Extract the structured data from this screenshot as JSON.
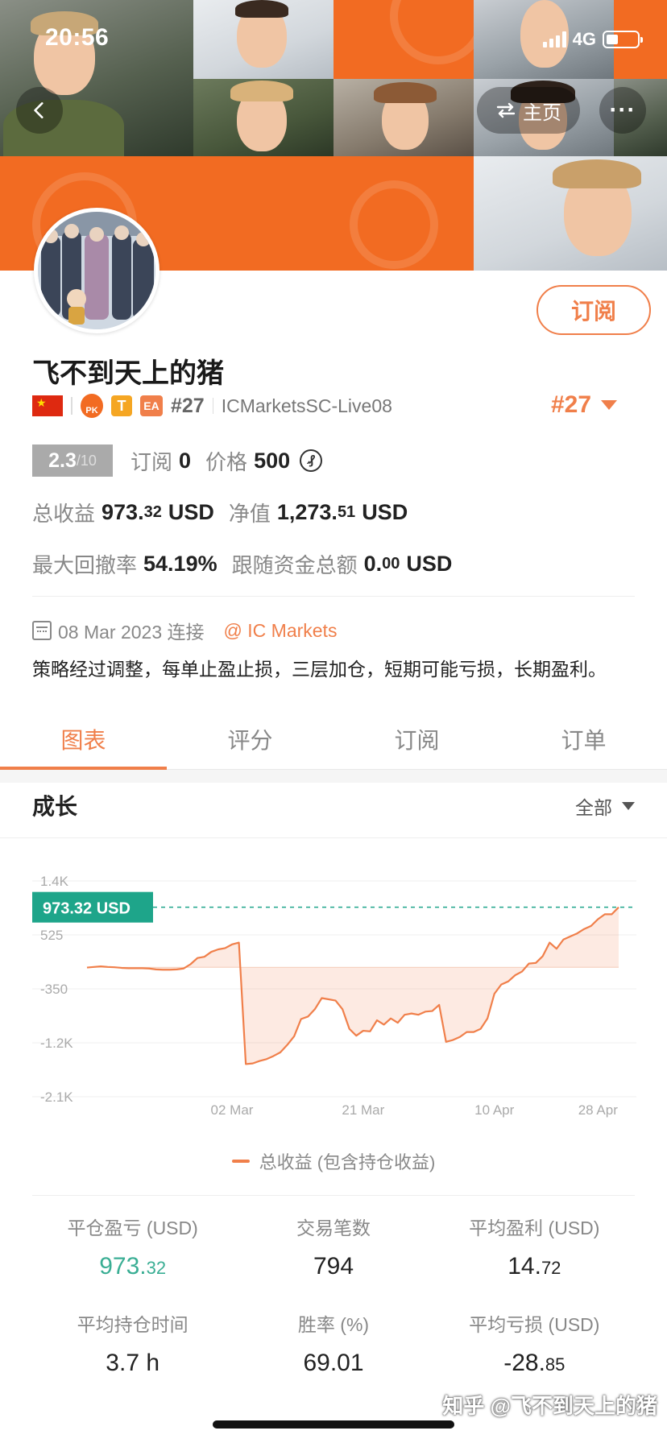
{
  "status_bar": {
    "time": "20:56",
    "network": "4G"
  },
  "nav": {
    "home_label": "主页",
    "more_label": "···"
  },
  "profile": {
    "username": "飞不到天上的猪",
    "subscribe_label": "订阅",
    "rank_small": "#27",
    "rank_big": "#27",
    "server": "ICMarketsSC-Live08",
    "badges": {
      "pk": "PK",
      "t": "T",
      "ea": "EA"
    }
  },
  "stats": {
    "score": "2.3",
    "score_max": "/10",
    "subscriptions_label": "订阅",
    "subscriptions_value": "0",
    "price_label": "价格",
    "price_value": "500",
    "price_currency_symbol": "₰",
    "total_profit_label": "总收益",
    "total_profit_int": "973.",
    "total_profit_dec": "32",
    "total_profit_unit": "USD",
    "equity_label": "净值",
    "equity_int": "1,273.",
    "equity_dec": "51",
    "equity_unit": "USD",
    "max_drawdown_label": "最大回撤率",
    "max_drawdown_value": "54.19%",
    "follow_funds_label": "跟随资金总额",
    "follow_funds_int": "0.",
    "follow_funds_dec": "00",
    "follow_funds_unit": "USD"
  },
  "connection": {
    "date": "08 Mar 2023 连接",
    "broker": "@ IC Markets"
  },
  "description": "策略经过调整，每单止盈止损，三层加仓，短期可能亏损，长期盈利。",
  "tabs": [
    {
      "label": "图表",
      "active": true
    },
    {
      "label": "评分",
      "active": false
    },
    {
      "label": "订阅",
      "active": false
    },
    {
      "label": "订单",
      "active": false
    }
  ],
  "chart_section": {
    "title": "成长",
    "filter_label": "全部"
  },
  "chart_data": {
    "type": "area",
    "current_value_label": "973.32 USD",
    "current_value": 973.32,
    "y_ticks": [
      "1.4K",
      "525",
      "-350",
      "-1.2K",
      "-2.1K"
    ],
    "y_tick_values": [
      1400,
      525,
      -350,
      -1225,
      -2100
    ],
    "ylim": [
      -2100,
      1400
    ],
    "x_ticks": [
      "02 Mar",
      "21 Mar",
      "10 Apr",
      "28 Apr"
    ],
    "x_tick_index": [
      21,
      40,
      59,
      74
    ],
    "x": [
      0,
      1,
      2,
      3,
      4,
      5,
      6,
      7,
      8,
      9,
      10,
      11,
      12,
      13,
      14,
      15,
      16,
      17,
      18,
      19,
      20,
      21,
      22,
      23,
      24,
      25,
      26,
      27,
      28,
      29,
      30,
      31,
      32,
      33,
      34,
      35,
      36,
      37,
      38,
      39,
      40,
      41,
      42,
      43,
      44,
      45,
      46,
      47,
      48,
      49,
      50,
      51,
      52,
      53,
      54,
      55,
      56,
      57,
      58,
      59,
      60,
      61,
      62,
      63,
      64,
      65,
      66,
      67,
      68,
      69,
      70,
      71,
      72,
      73,
      74,
      75,
      76,
      77
    ],
    "series": [
      {
        "name": "总收益 (包含持仓收益)",
        "color": "#f07f4a",
        "values": [
          -5,
          5,
          15,
          5,
          0,
          -10,
          -15,
          -15,
          -15,
          -20,
          -35,
          -40,
          -40,
          -35,
          -20,
          50,
          150,
          170,
          250,
          290,
          310,
          370,
          400,
          -1570,
          -1560,
          -1520,
          -1490,
          -1440,
          -1380,
          -1260,
          -1120,
          -840,
          -800,
          -680,
          -500,
          -520,
          -540,
          -680,
          -1000,
          -1110,
          -1030,
          -1040,
          -860,
          -930,
          -830,
          -900,
          -770,
          -750,
          -770,
          -720,
          -710,
          -610,
          -1210,
          -1180,
          -1130,
          -1050,
          -1050,
          -1000,
          -830,
          -430,
          -280,
          -230,
          -130,
          -70,
          60,
          70,
          180,
          400,
          300,
          450,
          500,
          550,
          620,
          670,
          780,
          860,
          860,
          973.32
        ]
      }
    ],
    "legend": [
      "总收益 (包含持仓收益)"
    ],
    "grid": true
  },
  "summary": [
    {
      "label": "平仓盈亏 (USD)",
      "int": "973.",
      "dec": "32",
      "green": true
    },
    {
      "label": "交易笔数",
      "int": "794",
      "dec": "",
      "green": false
    },
    {
      "label": "平均盈利 (USD)",
      "int": "14.",
      "dec": "72",
      "green": false
    },
    {
      "label": "平均持仓时间",
      "int": "3.7 h",
      "dec": "",
      "green": false
    },
    {
      "label": "胜率 (%)",
      "int": "69.01",
      "dec": "",
      "green": false
    },
    {
      "label": "平均亏损 (USD)",
      "int": "-28.",
      "dec": "85",
      "green": false
    }
  ],
  "watermark": "知乎 @飞不到天上的猪",
  "colors": {
    "accent": "#f07f4a",
    "banner_orange": "#f26b22",
    "profit_green": "#3aae94",
    "label_bg": "#1ea58a"
  }
}
